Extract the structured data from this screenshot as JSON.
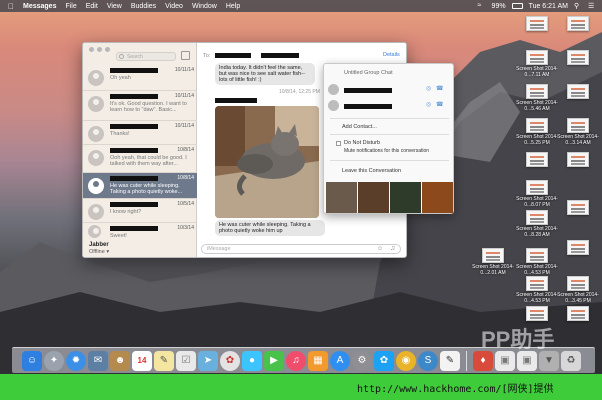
{
  "menubar": {
    "app_name": "Messages",
    "items": [
      "File",
      "Edit",
      "View",
      "Buddies",
      "Video",
      "Window",
      "Help"
    ],
    "battery": "99%",
    "clock": "Tue 6:21 AM"
  },
  "window": {
    "search_placeholder": "Search",
    "conversations": [
      {
        "date": "10/11/14",
        "preview": "Oh yeah"
      },
      {
        "date": "10/11/14",
        "preview": "It's ok. Good question. I want to learn how to \"daw\". Basic..."
      },
      {
        "date": "10/11/14",
        "preview": "Thanks!"
      },
      {
        "date": "10/8/14",
        "preview": "Ooh yeah, that could be good. I talked with them way after..."
      },
      {
        "date": "10/8/14",
        "preview": "He was cuter while sleeping. Taking a photo quietly woke..."
      },
      {
        "date": "10/5/14",
        "preview": "I know right?"
      },
      {
        "date": "10/3/14",
        "preview": "Sweet!"
      }
    ],
    "jabber_label": "Jabber",
    "offline_label": "Offline ▾"
  },
  "chat": {
    "to_label": "To:",
    "details_label": "Details",
    "msg1": "India today. It didn't feel the same, but was nice to see salt water fish--lots of little fish! :)",
    "timestamp": "10/8/14, 12:25 PM",
    "msg2": "He was cuter while sleeping. Taking a photo quietly woke him up",
    "input_placeholder": "iMessage"
  },
  "details_panel": {
    "group_title": "Untitled Group Chat",
    "add_contact": "Add Contact...",
    "dnd_label": "Do Not Disturb",
    "dnd_sub": "Mute notifications for this conversation",
    "leave_label": "Leave this Conversation"
  },
  "desktop": {
    "icons": [
      {
        "label": "Screen Shot 2014-0...7.11 AM"
      },
      {
        "label": "Screen Shot 2014-0...5.46 AM"
      },
      {
        "label": "Screen Shot 2014-0...5.25 PM"
      },
      {
        "label": "Screen Shot 2014-0...8.07 PM"
      },
      {
        "label": "Screen Shot 2014-0...8.28 AM"
      },
      {
        "label": "Screen Shot 2014-0...4.53 PM"
      },
      {
        "label": "Screen Shot 2014-0...4.53 PM"
      },
      {
        "label": "Screen Shot 2014-0...3.14 AM"
      },
      {
        "label": "Screen Shot 2014-0...2.01 AM"
      },
      {
        "label": "Screen Shot 2014-0...3.45 PM"
      }
    ]
  },
  "dock": {
    "calendar_day": "14"
  },
  "watermark": "PP助手",
  "footer_url": "http://www.hackhome.com/[网侠]提供"
}
